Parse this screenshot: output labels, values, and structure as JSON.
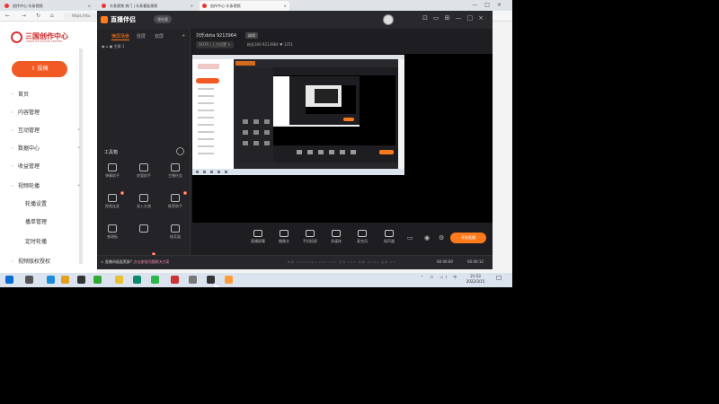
{
  "browser": {
    "tabs": [
      {
        "label": "创作中心-头条视频",
        "active": false
      },
      {
        "label": "头条视频 热门 | 头条看板视频",
        "active": false
      },
      {
        "label": "创作中心-头条视频",
        "active": true
      }
    ],
    "address": "https://stu"
  },
  "left_page": {
    "logo_text": "三国创作中心",
    "logo_sub": "CREATIVE STUDIO CENTER",
    "upload_label": "投稿",
    "menu": [
      {
        "label": "首页",
        "icon": "home-icon"
      },
      {
        "label": "内容管理",
        "icon": "document-icon"
      },
      {
        "label": "互动管理",
        "icon": "chat-icon",
        "expand": true
      },
      {
        "label": "数据中心",
        "icon": "chart-icon",
        "expand": true
      },
      {
        "label": "收益管理",
        "icon": "wallet-icon"
      },
      {
        "label": "视频轮播",
        "icon": "video-icon",
        "expand": true
      },
      {
        "label": "轮播设置",
        "icon": ""
      },
      {
        "label": "播单管理",
        "icon": ""
      },
      {
        "label": "定时轮播",
        "icon": ""
      },
      {
        "label": "视频版权授权",
        "icon": "shield-icon"
      }
    ]
  },
  "app": {
    "name": "直播伴侣",
    "version": "领先版",
    "scene_tabs": [
      "横屏场景",
      "竖屏",
      "双屏"
    ],
    "scene_item": "主屏 1",
    "toolbox_label": "工具箱",
    "tools": [
      {
        "label": "弹幕助手",
        "new": false
      },
      {
        "label": "房管助手",
        "new": false
      },
      {
        "label": "主播任务",
        "new": false
      },
      {
        "label": "视频连麦",
        "new": true
      },
      {
        "label": "录入礼物",
        "new": false
      },
      {
        "label": "推荐助手",
        "new": true
      },
      {
        "label": "感谢板",
        "new": false
      },
      {
        "label": "",
        "new": false
      },
      {
        "label": "抽奖器",
        "new": false
      },
      {
        "label": "",
        "new": false
      },
      {
        "label": "",
        "new": true
      },
      {
        "label": "",
        "new": false
      }
    ],
    "room_title": "刘乐dota 9213964",
    "edit_label": "编辑",
    "category": "DOTA",
    "category_action": "上方设置",
    "meta": "粉丝300   9213964   ♥ 1251",
    "controls": [
      "直播屏幕",
      "摄像头",
      "手机投屏",
      "多媒体",
      "麦克风",
      "扬声器"
    ],
    "start_button": "开始直播",
    "status_message": "直播间画面黑屏? ",
    "status_link": "点击查找问题解决方案",
    "metrics": "码率 0000kbps   CPU 23%   内存 35%   帧率 00fps   丢帧 0%",
    "timer_left": "00:00:00",
    "timer_right": "00:00:12"
  },
  "taskbar": {
    "time": "21:53",
    "date": "2022/3/15",
    "tray": "⌃ ⎔ ◁) 中"
  }
}
